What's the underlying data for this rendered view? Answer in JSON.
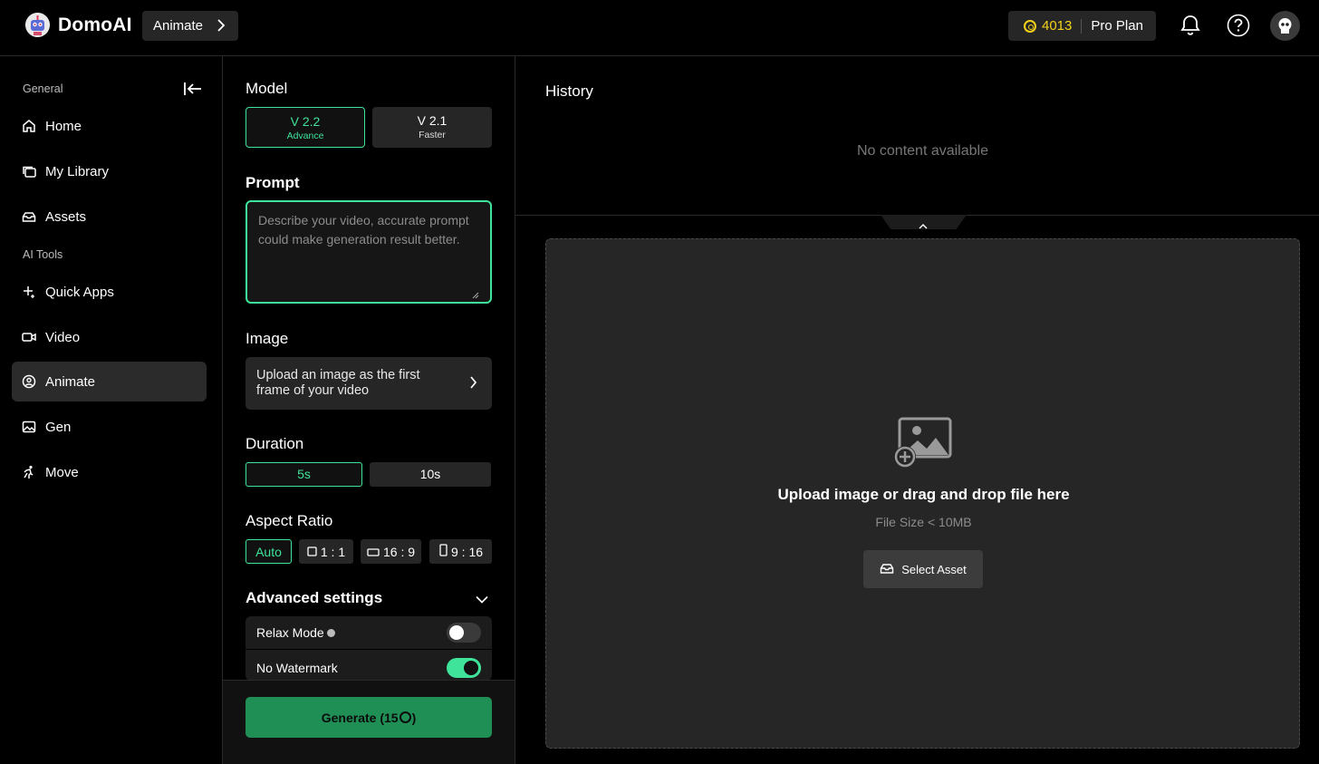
{
  "app": {
    "name": "DomoAI",
    "breadcrumb": "Animate",
    "credits": "4013",
    "plan": "Pro Plan"
  },
  "colors": {
    "accent": "#3fe39a",
    "generate": "#1f8f55",
    "credit": "#f5d21a"
  },
  "sidebar": {
    "general_label": "General",
    "tools_label": "AI Tools",
    "items": [
      {
        "label": "Home",
        "icon": "home-icon"
      },
      {
        "label": "My Library",
        "icon": "library-icon"
      },
      {
        "label": "Assets",
        "icon": "assets-icon"
      },
      {
        "label": "Quick Apps",
        "icon": "sparkle-icon"
      },
      {
        "label": "Video",
        "icon": "video-icon"
      },
      {
        "label": "Animate",
        "icon": "animate-icon",
        "active": true
      },
      {
        "label": "Gen",
        "icon": "image-icon"
      },
      {
        "label": "Move",
        "icon": "run-icon"
      }
    ]
  },
  "panel": {
    "model_title": "Model",
    "models": [
      {
        "version": "V 2.2",
        "desc": "Advance",
        "selected": true
      },
      {
        "version": "V 2.1",
        "desc": "Faster",
        "selected": false
      }
    ],
    "prompt_title": "Prompt",
    "prompt_placeholder": "Describe your video, accurate prompt could make generation result better.",
    "prompt_value": "",
    "image_title": "Image",
    "image_upload_text": "Upload an image as the first frame of your video",
    "duration_title": "Duration",
    "durations": [
      {
        "label": "5s",
        "selected": true
      },
      {
        "label": "10s",
        "selected": false
      }
    ],
    "aspect_title": "Aspect Ratio",
    "aspects": [
      {
        "label": "Auto",
        "selected": true
      },
      {
        "label": "1 : 1",
        "selected": false
      },
      {
        "label": "16 : 9",
        "selected": false
      },
      {
        "label": "9 : 16",
        "selected": false
      }
    ],
    "advanced_title": "Advanced settings",
    "settings": [
      {
        "label": "Relax Mode",
        "enabled": false
      },
      {
        "label": "No Watermark",
        "enabled": true
      }
    ],
    "generate_label": "Generate (15",
    "generate_suffix": ")"
  },
  "history": {
    "title": "History",
    "empty_text": "No content available"
  },
  "upload": {
    "title": "Upload image or drag and drop file here",
    "subtitle": "File Size < 10MB",
    "select_label": "Select Asset"
  }
}
